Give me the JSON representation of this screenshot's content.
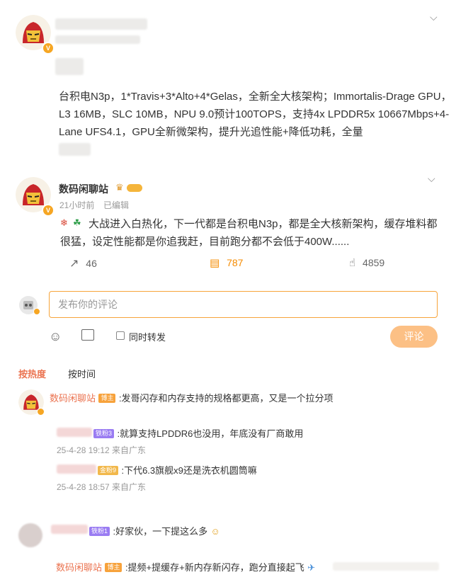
{
  "post1": {
    "text": "台积电N3p，1*Travis+3*Alto+4*Gelas，全新全大核架构；Immortalis-Drage GPU，L3 16MB，SLC 10MB，NPU 9.0预计100TOPS，支持4x LPDDR5x 10667Mbps+4-Lane UFS4.1，GPU全新微架构，提升光追性能+降低功耗，全量"
  },
  "post2": {
    "author": "数码闲聊站",
    "time": "21小时前",
    "edited": "已编辑",
    "text": "大战进入白热化，下一代都是台积电N3p，都是全大核新架构，缓存堆料都很猛，设定性能都是你追我赶，目前跑分都不会低于400W......",
    "repost_count": "46",
    "comment_count": "787",
    "like_count": "4859"
  },
  "composer": {
    "placeholder": "发布你的评论",
    "also_repost_label": "同时转发",
    "submit_label": "评论"
  },
  "sort_tabs": {
    "hot": "按热度",
    "time": "按时间"
  },
  "comments": [
    {
      "author": "数码闲聊站",
      "badge": "博主",
      "text": ":发哥闪存和内存支持的规格都更高，又是一个拉分项",
      "replies": [
        {
          "badge": "铁粉3",
          "text": ":就算支持LPDDR6也没用，年底没有厂商敢用",
          "time": "25-4-28 19:12 来自广东"
        },
        {
          "badge": "金粉9",
          "text": ":下代6.3旗舰x9还是洗衣机圆筒嘛",
          "time": "25-4-28 18:57 来自广东"
        }
      ]
    },
    {
      "badge": "铁粉1",
      "text": ":好家伙，一下提这么多",
      "reply": {
        "author": "数码闲聊站",
        "badge": "博主",
        "text": ":提频+提缓存+新内存新闪存，跑分直接起飞"
      }
    }
  ],
  "colors": {
    "accent": "#f58b00",
    "author": "#eb7350",
    "input_border": "#f7a43a",
    "button": "#fcc085"
  }
}
